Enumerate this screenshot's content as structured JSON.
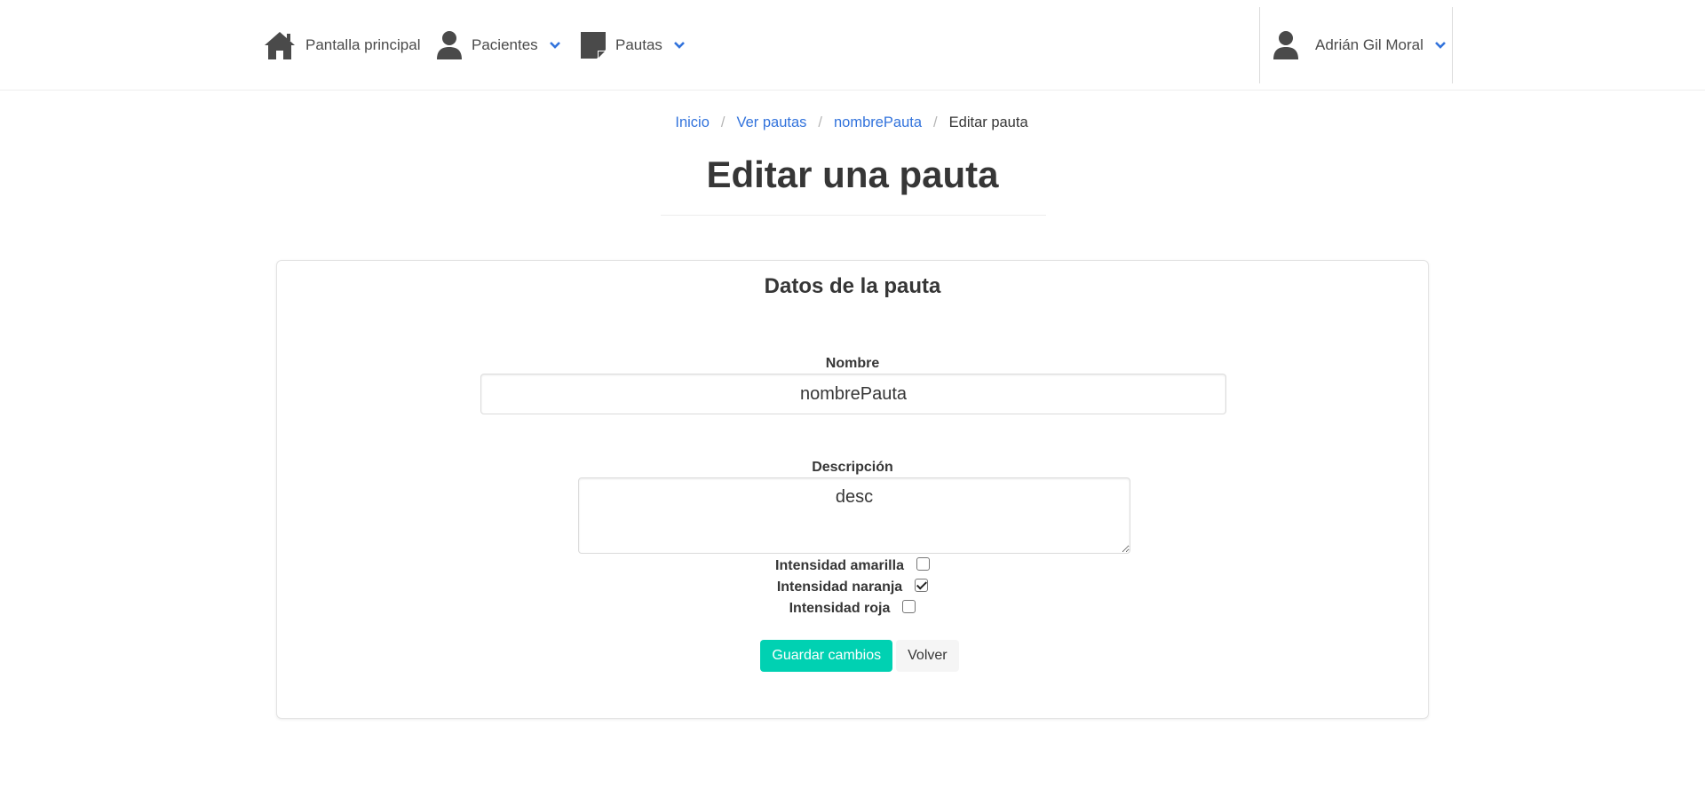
{
  "navbar": {
    "home": {
      "label": "Pantalla principal",
      "icon": "home-icon"
    },
    "patients": {
      "label": "Pacientes",
      "icon": "user-icon"
    },
    "pautas": {
      "label": "Pautas",
      "icon": "sticky-note-icon"
    },
    "user": {
      "label": "Adrián Gil Moral",
      "icon": "user-icon"
    }
  },
  "colors": {
    "accent": "#3273dc",
    "primary_button": "#00d1b2",
    "text": "#363636"
  },
  "breadcrumb": {
    "items": [
      "Inicio",
      "Ver pautas",
      "nombrePauta"
    ],
    "current": "Editar pauta",
    "separator": "/"
  },
  "page": {
    "title": "Editar una pauta"
  },
  "form": {
    "card_title": "Datos de la pauta",
    "name_label": "Nombre",
    "name_value": "nombrePauta",
    "description_label": "Descripción",
    "description_value": "desc",
    "checkboxes": [
      {
        "label": "Intensidad amarilla",
        "checked": false
      },
      {
        "label": "Intensidad naranja",
        "checked": true
      },
      {
        "label": "Intensidad roja",
        "checked": false
      }
    ],
    "save_label": "Guardar cambios",
    "back_label": "Volver"
  }
}
